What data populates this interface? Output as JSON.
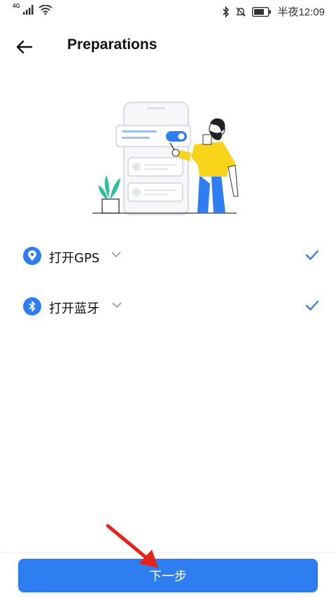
{
  "status_bar": {
    "network_label": "4G",
    "time": "半夜12:09",
    "icons": [
      "signal-icon",
      "wifi-icon",
      "bluetooth-icon",
      "mute-icon",
      "battery-icon"
    ]
  },
  "header": {
    "back_icon": "arrow-left-icon",
    "title": "Preparations"
  },
  "checklist": [
    {
      "label": "打开GPS",
      "icon": "location-pin-icon",
      "checked": true
    },
    {
      "label": "打开蓝牙",
      "icon": "bluetooth-icon",
      "checked": true
    }
  ],
  "footer": {
    "next_label": "下一步"
  },
  "colors": {
    "accent": "#2f7ef1",
    "check": "#2f7ef1",
    "annotation_arrow": "#e5231b",
    "person_shirt": "#f7d31a",
    "person_pants": "#2f7ef1",
    "plant": "#2bbf9a"
  }
}
